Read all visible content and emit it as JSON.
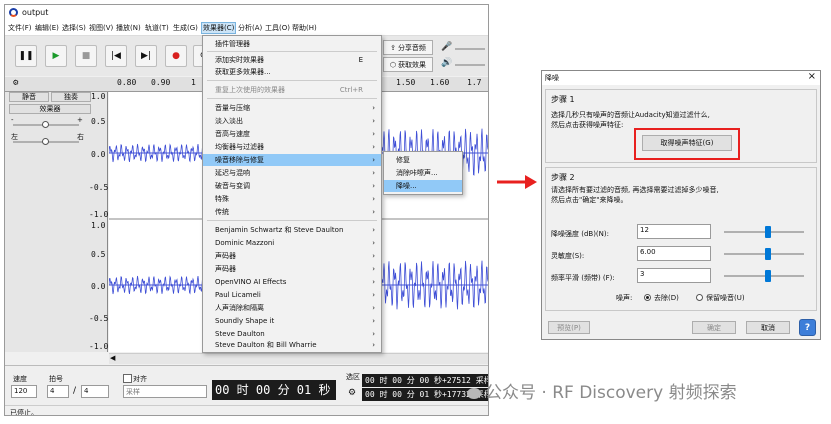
{
  "window_title": "output",
  "menubar": [
    "文件(F)",
    "编辑(E)",
    "选择(S)",
    "视图(V)",
    "播放(N)",
    "轨道(T)",
    "生成(G)",
    "效果器(C)",
    "分析(A)",
    "工具(O)",
    "帮助(H)"
  ],
  "toolbar": {
    "share_audio": "分享音频",
    "get_effects": "获取效果"
  },
  "timeline_ticks": [
    "0.80",
    "0.90",
    "1",
    "1.50",
    "1.60",
    "1.7"
  ],
  "track_panel": {
    "mute": "静音",
    "solo": "独奏",
    "effects": "效果器",
    "minus": "-",
    "plus": "+",
    "left": "左",
    "right": "右"
  },
  "amplitude_labels": [
    "1.0",
    "0.5",
    "0.0",
    "-0.5",
    "-1.0",
    "1.0",
    "0.5",
    "0.0",
    "-0.5",
    "-1.0"
  ],
  "effects_menu": {
    "items": [
      {
        "label": "插件管理器"
      },
      {
        "label": "添加实时效果器",
        "shortcut": "E"
      },
      {
        "label": "获取更多效果器..."
      },
      {
        "label": "重复上次使用的效果器",
        "shortcut": "Ctrl+R"
      },
      {
        "label": "音量与压缩"
      },
      {
        "label": "淡入淡出"
      },
      {
        "label": "音高与速度"
      },
      {
        "label": "均衡器与过滤器"
      },
      {
        "label": "噪音移除与修复"
      },
      {
        "label": "延迟与混响"
      },
      {
        "label": "破音与变调"
      },
      {
        "label": "特殊"
      },
      {
        "label": "传统"
      },
      {
        "label": "Benjamin Schwartz 和 Steve Daulton"
      },
      {
        "label": "Dominic Mazzoni"
      },
      {
        "label": "声码器"
      },
      {
        "label": "声码器"
      },
      {
        "label": "OpenVINO AI Effects"
      },
      {
        "label": "Paul Licameli"
      },
      {
        "label": "人声消除和隔离"
      },
      {
        "label": "Soundly Shape it"
      },
      {
        "label": "Steve Daulton"
      },
      {
        "label": "Steve Daulton 和 Bill Wharrie"
      }
    ]
  },
  "submenu": {
    "items": [
      "修复",
      "消除咔嚓声...",
      "降噪..."
    ]
  },
  "bottombar": {
    "rate_label": "速度",
    "rate_value": "120",
    "beat_label": "拍号",
    "beat_num": "4",
    "beat_sep": "/",
    "beat_den": "4",
    "snap_label": "对齐",
    "snap_value": "采样",
    "time_main": "00 时 00 分 01 秒",
    "selection_label": "选区",
    "sel_start": "00 时 00 分 00 秒+27512 采样",
    "sel_end": "00 时 00 分 01 秒+17732 采样"
  },
  "status": "已停止。",
  "dialog": {
    "title": "降噪",
    "step1_title": "步骤 1",
    "step1_text_1": "选择几秒只有噪声的音频让Audacity知道过滤什么,",
    "step1_text_2": "然后点击获得噪声特征:",
    "profile_button": "取得噪声特征(G)",
    "step2_title": "步骤 2",
    "step2_text_1": "请选择所有要过滤的音频, 再选择需要过滤掉多少噪音,",
    "step2_text_2": "然后点击\"确定\"来降噪。",
    "params": [
      {
        "label": "降噪强度 (dB)(N):",
        "value": "12",
        "level": 0.55
      },
      {
        "label": "灵敏度(S):",
        "value": "6.00",
        "level": 0.55
      },
      {
        "label": "频率平滑 (频带) (F):",
        "value": "3",
        "level": 0.55
      }
    ],
    "noise_label": "噪声:",
    "remove_option": "去除(D)",
    "residue_option": "保留噪音(U)",
    "preview_button": "预览(P)",
    "ok_button": "确定",
    "cancel_button": "取消",
    "help_button": "?"
  },
  "watermark": "公众号 · RF Discovery 射频探索",
  "colors": {
    "waveform": "#3f4fd6",
    "highlight": "#91c9f7",
    "callout": "#e8201f",
    "accent": "#0078d7"
  }
}
